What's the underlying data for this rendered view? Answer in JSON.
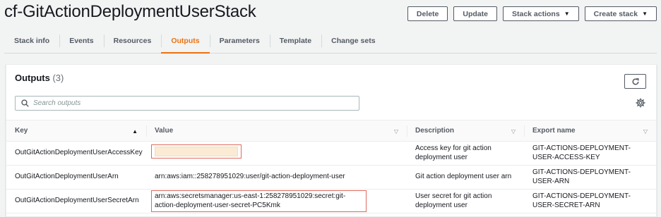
{
  "stack": {
    "title": "cf-GitActionDeploymentUserStack"
  },
  "header_actions": {
    "delete": "Delete",
    "update": "Update",
    "stack_actions": "Stack actions",
    "create_stack": "Create stack"
  },
  "tabs": [
    {
      "label": "Stack info"
    },
    {
      "label": "Events"
    },
    {
      "label": "Resources"
    },
    {
      "label": "Outputs",
      "active": true
    },
    {
      "label": "Parameters"
    },
    {
      "label": "Template"
    },
    {
      "label": "Change sets"
    }
  ],
  "outputs": {
    "title": "Outputs",
    "count": "(3)",
    "search_placeholder": "Search outputs",
    "columns": {
      "key": "Key",
      "value": "Value",
      "description": "Description",
      "export_name": "Export name"
    },
    "rows": [
      {
        "key": "OutGitActionDeploymentUserAccessKey",
        "value": "",
        "value_redacted": true,
        "description": "Access key for git action deployment user",
        "export_name": "GIT-ACTIONS-DEPLOYMENT-USER-ACCESS-KEY"
      },
      {
        "key": "OutGitActionDeploymentUserArn",
        "value": "arn:aws:iam::258278951029:user/git-action-deployment-user",
        "description": "Git action deployment user arn",
        "export_name": "GIT-ACTIONS-DEPLOYMENT-USER-ARN"
      },
      {
        "key": "OutGitActionDeploymentUserSecretArn",
        "value": "arn:aws:secretsmanager:us-east-1:258278951029:secret:git-action-deployment-user-secret-PC5Kmk",
        "description": "User secret for git action deployment user",
        "export_name": "GIT-ACTIONS-DEPLOYMENT-USER-SECRET-ARN"
      }
    ]
  },
  "colors": {
    "accent": "#ec7211",
    "highlight_border": "#e06b5e",
    "redaction": "#fbebd4"
  }
}
